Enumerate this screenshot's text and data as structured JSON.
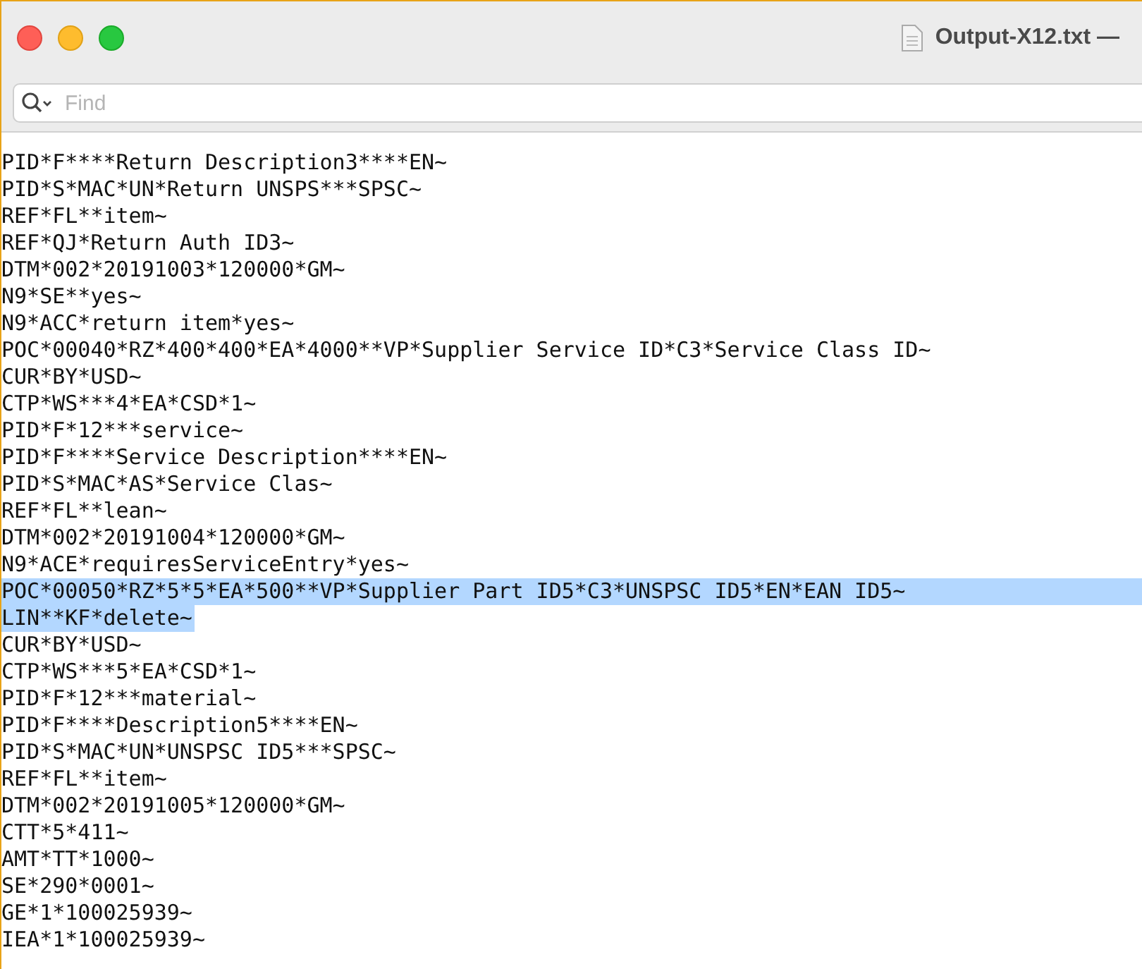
{
  "window": {
    "title": "Output-X12.txt —"
  },
  "search": {
    "placeholder": "Find"
  },
  "lines": [
    {
      "text": "PID*F****Return Description3****EN~",
      "selected": false
    },
    {
      "text": "PID*S*MAC*UN*Return UNSPS***SPSC~",
      "selected": false
    },
    {
      "text": "REF*FL**item~",
      "selected": false
    },
    {
      "text": "REF*QJ*Return Auth ID3~",
      "selected": false
    },
    {
      "text": "DTM*002*20191003*120000*GM~",
      "selected": false
    },
    {
      "text": "N9*SE**yes~",
      "selected": false
    },
    {
      "text": "N9*ACC*return item*yes~",
      "selected": false
    },
    {
      "text": "POC*00040*RZ*400*400*EA*4000**VP*Supplier Service ID*C3*Service Class ID~",
      "selected": false
    },
    {
      "text": "CUR*BY*USD~",
      "selected": false
    },
    {
      "text": "CTP*WS***4*EA*CSD*1~",
      "selected": false
    },
    {
      "text": "PID*F*12***service~",
      "selected": false
    },
    {
      "text": "PID*F****Service Description****EN~",
      "selected": false
    },
    {
      "text": "PID*S*MAC*AS*Service Clas~",
      "selected": false
    },
    {
      "text": "REF*FL**lean~",
      "selected": false
    },
    {
      "text": "DTM*002*20191004*120000*GM~",
      "selected": false
    },
    {
      "text": "N9*ACE*requiresServiceEntry*yes~",
      "selected": false
    },
    {
      "text": "POC*00050*RZ*5*5*EA*500**VP*Supplier Part ID5*C3*UNSPSC ID5*EN*EAN ID5~",
      "selected": true
    },
    {
      "text": "LIN**KF*delete~",
      "selected": true
    },
    {
      "text": "CUR*BY*USD~",
      "selected": false
    },
    {
      "text": "CTP*WS***5*EA*CSD*1~",
      "selected": false
    },
    {
      "text": "PID*F*12***material~",
      "selected": false
    },
    {
      "text": "PID*F****Description5****EN~",
      "selected": false
    },
    {
      "text": "PID*S*MAC*UN*UNSPSC ID5***SPSC~",
      "selected": false
    },
    {
      "text": "REF*FL**item~",
      "selected": false
    },
    {
      "text": "DTM*002*20191005*120000*GM~",
      "selected": false
    },
    {
      "text": "CTT*5*411~",
      "selected": false
    },
    {
      "text": "AMT*TT*1000~",
      "selected": false
    },
    {
      "text": "SE*290*0001~",
      "selected": false
    },
    {
      "text": "GE*1*100025939~",
      "selected": false
    },
    {
      "text": "IEA*1*100025939~",
      "selected": false
    }
  ]
}
